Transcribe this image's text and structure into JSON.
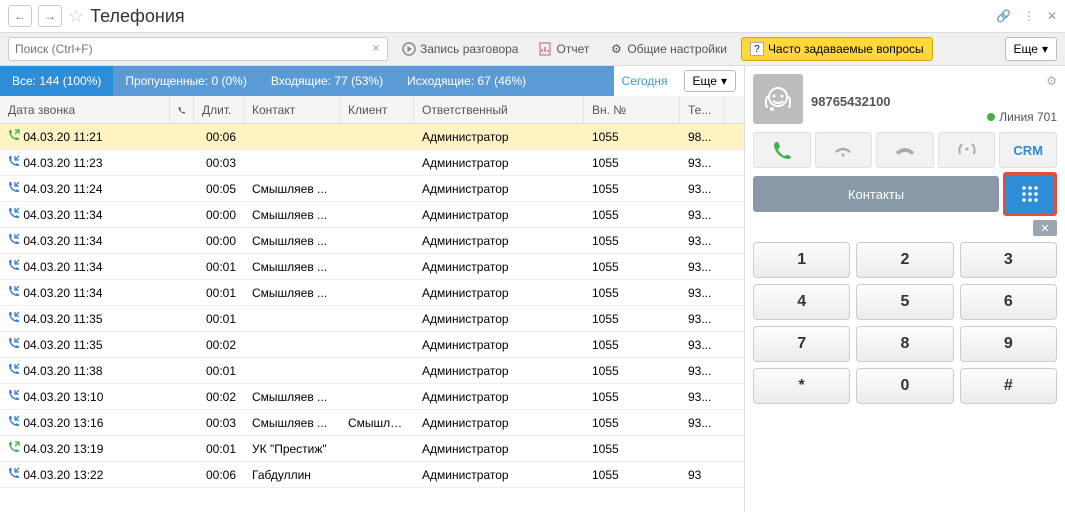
{
  "title": "Телефония",
  "search": {
    "placeholder": "Поиск (Ctrl+F)"
  },
  "toolbar": {
    "record": "Запись разговора",
    "report": "Отчет",
    "settings": "Общие настройки",
    "faq": "Часто задаваемые вопросы",
    "more": "Еще"
  },
  "filters": {
    "all": "Все: 144 (100%)",
    "missed": "Пропущенные: 0 (0%)",
    "incoming": "Входящие: 77 (53%)",
    "outgoing": "Исходящие: 67 (46%)",
    "today": "Сегодня",
    "more": "Еще"
  },
  "columns": {
    "date": "Дата звонка",
    "dur": "Длит.",
    "contact": "Контакт",
    "client": "Клиент",
    "resp": "Ответственный",
    "ext": "Вн. №",
    "tel": "Те..."
  },
  "rows": [
    {
      "dir": "out",
      "date": "04.03.20 11:21",
      "dur": "00:06",
      "contact": "",
      "client": "",
      "resp": "Администратор",
      "ext": "1055",
      "tel": "98..."
    },
    {
      "dir": "in",
      "date": "04.03.20 11:23",
      "dur": "00:03",
      "contact": "",
      "client": "",
      "resp": "Администратор",
      "ext": "1055",
      "tel": "93..."
    },
    {
      "dir": "in",
      "date": "04.03.20 11:24",
      "dur": "00:05",
      "contact": "Смышляев ...",
      "client": "",
      "resp": "Администратор",
      "ext": "1055",
      "tel": "93..."
    },
    {
      "dir": "in",
      "date": "04.03.20 11:34",
      "dur": "00:00",
      "contact": "Смышляев ...",
      "client": "",
      "resp": "Администратор",
      "ext": "1055",
      "tel": "93..."
    },
    {
      "dir": "in",
      "date": "04.03.20 11:34",
      "dur": "00:00",
      "contact": "Смышляев ...",
      "client": "",
      "resp": "Администратор",
      "ext": "1055",
      "tel": "93..."
    },
    {
      "dir": "in",
      "date": "04.03.20 11:34",
      "dur": "00:01",
      "contact": "Смышляев ...",
      "client": "",
      "resp": "Администратор",
      "ext": "1055",
      "tel": "93..."
    },
    {
      "dir": "in",
      "date": "04.03.20 11:34",
      "dur": "00:01",
      "contact": "Смышляев ...",
      "client": "",
      "resp": "Администратор",
      "ext": "1055",
      "tel": "93..."
    },
    {
      "dir": "in",
      "date": "04.03.20 11:35",
      "dur": "00:01",
      "contact": "",
      "client": "",
      "resp": "Администратор",
      "ext": "1055",
      "tel": "93..."
    },
    {
      "dir": "in",
      "date": "04.03.20 11:35",
      "dur": "00:02",
      "contact": "",
      "client": "",
      "resp": "Администратор",
      "ext": "1055",
      "tel": "93..."
    },
    {
      "dir": "in",
      "date": "04.03.20 11:38",
      "dur": "00:01",
      "contact": "",
      "client": "",
      "resp": "Администратор",
      "ext": "1055",
      "tel": "93..."
    },
    {
      "dir": "in",
      "date": "04.03.20 13:10",
      "dur": "00:02",
      "contact": "Смышляев ...",
      "client": "",
      "resp": "Администратор",
      "ext": "1055",
      "tel": "93..."
    },
    {
      "dir": "in",
      "date": "04.03.20 13:16",
      "dur": "00:03",
      "contact": "Смышляев ...",
      "client": "Смышля...",
      "resp": "Администратор",
      "ext": "1055",
      "tel": "93..."
    },
    {
      "dir": "out",
      "date": "04.03.20 13:19",
      "dur": "00:01",
      "contact": "УК \"Престиж\"",
      "client": "",
      "resp": "Администратор",
      "ext": "1055",
      "tel": ""
    },
    {
      "dir": "in",
      "date": "04.03.20 13:22",
      "dur": "00:06",
      "contact": "Габдуллин",
      "client": "",
      "resp": "Администратор",
      "ext": "1055",
      "tel": "93"
    }
  ],
  "phone": {
    "number": "98765432100",
    "line": "Линия 701",
    "crm": "CRM",
    "contacts": "Контакты"
  },
  "dialpad": [
    "1",
    "2",
    "3",
    "4",
    "5",
    "6",
    "7",
    "8",
    "9",
    "*",
    "0",
    "#"
  ]
}
